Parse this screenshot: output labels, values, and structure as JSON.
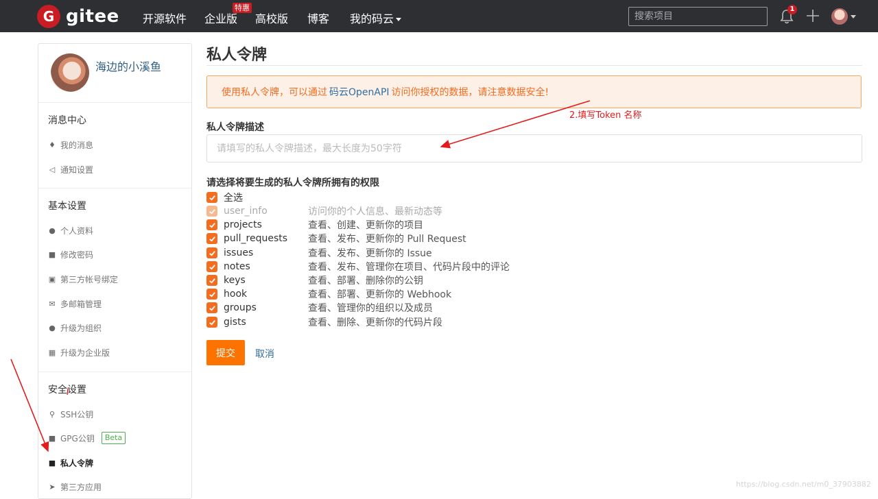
{
  "header": {
    "logo_text": "gitee",
    "nav": [
      "开源软件",
      "企业版",
      "高校版",
      "博客",
      "我的码云"
    ],
    "hot_badge": "特惠",
    "search_placeholder": "搜索项目",
    "notification_count": "1"
  },
  "sidebar": {
    "username": "海边的小溪鱼",
    "sections": [
      {
        "title": "消息中心",
        "items": [
          "我的消息",
          "通知设置"
        ]
      },
      {
        "title": "基本设置",
        "items": [
          "个人资料",
          "修改密码",
          "第三方帐号绑定",
          "多邮箱管理",
          "升级为组织",
          "升级为企业版"
        ]
      },
      {
        "title": "安全设置",
        "items": [
          "SSH公钥",
          "GPG公钥",
          "私人令牌",
          "第三方应用"
        ]
      }
    ],
    "beta_label": "Beta",
    "active_item": "私人令牌"
  },
  "main": {
    "title": "私人令牌",
    "alert": {
      "prefix": "使用私人令牌，可以通过",
      "link": "码云OpenAPI",
      "suffix": "访问你授权的数据，请注意数据安全!"
    },
    "description_label": "私人令牌描述",
    "description_placeholder": "请填写的私人令牌描述，最大长度为50字符",
    "permissions_label": "请选择将要生成的私人令牌所拥有的权限",
    "select_all_label": "全选",
    "permissions": [
      {
        "name": "user_info",
        "desc": "访问你的个人信息、最新动态等",
        "checked": true,
        "disabled": true
      },
      {
        "name": "projects",
        "desc": "查看、创建、更新你的项目",
        "checked": true,
        "disabled": false
      },
      {
        "name": "pull_requests",
        "desc": "查看、发布、更新你的 Pull Request",
        "checked": true,
        "disabled": false
      },
      {
        "name": "issues",
        "desc": "查看、发布、更新你的 Issue",
        "checked": true,
        "disabled": false
      },
      {
        "name": "notes",
        "desc": "查看、发布、管理你在项目、代码片段中的评论",
        "checked": true,
        "disabled": false
      },
      {
        "name": "keys",
        "desc": "查看、部署、删除你的公钥",
        "checked": true,
        "disabled": false
      },
      {
        "name": "hook",
        "desc": "查看、部署、更新你的 Webhook",
        "checked": true,
        "disabled": false
      },
      {
        "name": "groups",
        "desc": "查看、管理你的组织以及成员",
        "checked": true,
        "disabled": false
      },
      {
        "name": "gists",
        "desc": "查看、删除、更新你的代码片段",
        "checked": true,
        "disabled": false
      }
    ],
    "submit_label": "提交",
    "cancel_label": "取消"
  },
  "annotation": {
    "text": "2.填写Token 名称",
    "color": "#e41b1b"
  },
  "watermark": "https://blog.csdn.net/m0_37903882",
  "colors": {
    "accent": "#fe7300",
    "nav_bg": "#2d2f33",
    "brand_red": "#c71d23",
    "link": "#2f6ea3"
  }
}
